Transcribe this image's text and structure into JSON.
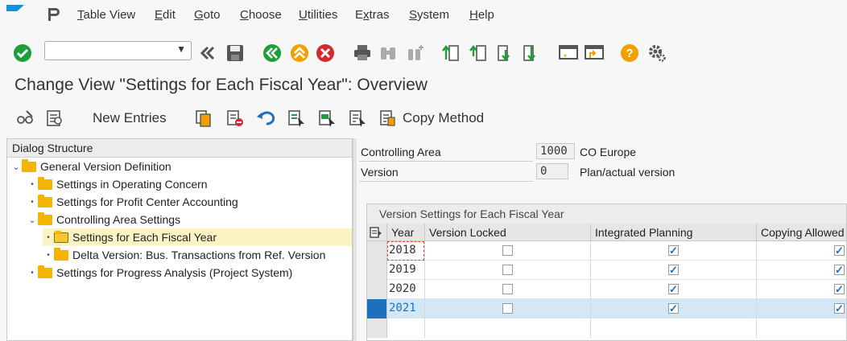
{
  "menu": [
    {
      "label": "Table View",
      "u": "T",
      "rest": "able View"
    },
    {
      "label": "Edit",
      "u": "E",
      "rest": "dit"
    },
    {
      "label": "Goto",
      "u": "G",
      "rest": "oto"
    },
    {
      "label": "Choose",
      "u": "C",
      "rest": "hoose"
    },
    {
      "label": "Utilities",
      "u": "U",
      "rest": "tilities"
    },
    {
      "label": "Extras",
      "u": "x",
      "rest": "tras"
    },
    {
      "label": "System",
      "u": "S",
      "rest": "ystem"
    },
    {
      "label": "Help",
      "u": "H",
      "rest": "elp"
    }
  ],
  "title": "Change View \"Settings for Each Fiscal Year\": Overview",
  "app_toolbar": {
    "new_entries": "New Entries",
    "copy_method": "Copy Method"
  },
  "dialog": {
    "header": "Dialog Structure",
    "items": [
      "General Version Definition",
      "Settings in Operating Concern",
      "Settings for Profit Center Accounting",
      "Controlling Area Settings",
      "Settings for Each Fiscal Year",
      "Delta Version: Bus. Transactions from Ref. Version",
      "Settings for Progress Analysis (Project System)"
    ]
  },
  "fields": {
    "controlling_area_label": "Controlling Area",
    "controlling_area_value": "1000",
    "controlling_area_desc": "CO Europe",
    "version_label": "Version",
    "version_value": "0",
    "version_desc": "Plan/actual version"
  },
  "table": {
    "title": "Version Settings for Each Fiscal Year",
    "columns": [
      "Year",
      "Version Locked",
      "Integrated Planning",
      "Copying Allowed"
    ],
    "rows": [
      {
        "year": "2018",
        "locked": false,
        "integrated": true,
        "copying": true
      },
      {
        "year": "2019",
        "locked": false,
        "integrated": true,
        "copying": true
      },
      {
        "year": "2020",
        "locked": false,
        "integrated": true,
        "copying": true
      },
      {
        "year": "2021",
        "locked": false,
        "integrated": true,
        "copying": true
      }
    ]
  },
  "colors": {
    "accent": "#1f6fbf",
    "folder": "#f5b400",
    "enter_green": "#1e9e3a",
    "cancel_red": "#d42a2a",
    "help_orange": "#f0a000"
  }
}
